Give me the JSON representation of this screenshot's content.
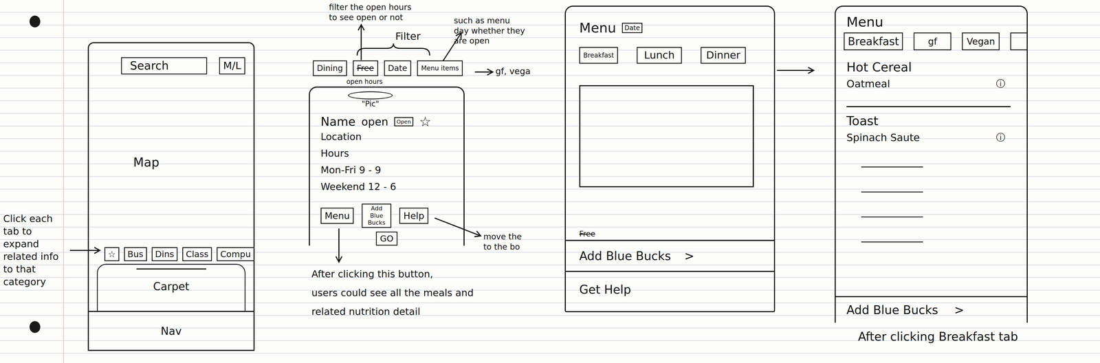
{
  "map_screen": {
    "search": "Search",
    "toggle": "M/L",
    "map": "Map",
    "tabs": [
      "☆",
      "Bus",
      "Dins",
      "Class",
      "Compu"
    ],
    "drawer": "Carpet",
    "nav": "Nav",
    "note": [
      "Click each",
      "tab to",
      "expand",
      "related info",
      "to that",
      "category"
    ]
  },
  "detail_card": {
    "hours_note": [
      "filter the open hours",
      "to see open or not"
    ],
    "filter_label": "Filter",
    "menu_note": [
      "such as menu",
      "day whether they",
      "are open"
    ],
    "menu_items_note": "gf, vega",
    "tabs": [
      {
        "label": "Dining",
        "struck": false
      },
      {
        "label": "Free",
        "struck": true
      },
      {
        "label": "Date",
        "struck": false
      },
      {
        "label": "Menu items",
        "struck": false
      }
    ],
    "tab_caption": "open hours",
    "pic": "\"Pic\"",
    "name": "Name",
    "status": "open",
    "badge": "Open",
    "favorite": "☆",
    "location": "Location",
    "hours_label": "Hours",
    "hours": [
      "Mon-Fri 9 - 9",
      "Weekend 12 - 6"
    ],
    "buttons": [
      "Menu",
      "Add Blue Bucks",
      "Help"
    ],
    "go": "GO",
    "help_note": [
      "move the",
      "to the bo"
    ],
    "menu_button_note": [
      "After clicking this button,",
      "users could see all the meals and",
      "related nutrition detail"
    ]
  },
  "menu_screen": {
    "title": "Menu",
    "date": "Date",
    "tabs": [
      "Breakfast",
      "Lunch",
      "Dinner"
    ],
    "free": {
      "label": "Free",
      "struck": true
    },
    "add": "Add Blue Bucks",
    "add_icon": ">",
    "help": "Get Help"
  },
  "breakfast_screen": {
    "title": "Menu",
    "tabs": [
      "Breakfast",
      "gf",
      "Vegan"
    ],
    "sections": [
      {
        "heading": "Hot Cereal",
        "items": [
          {
            "name": "Oatmeal",
            "icon": "ⓘ"
          }
        ]
      },
      {
        "heading": "Toast",
        "items": [
          {
            "name": "Spinach Saute",
            "icon": "ⓘ"
          }
        ]
      }
    ],
    "add": "Add Blue Bucks",
    "add_icon": ">",
    "caption": "After clicking Breakfast tab"
  }
}
